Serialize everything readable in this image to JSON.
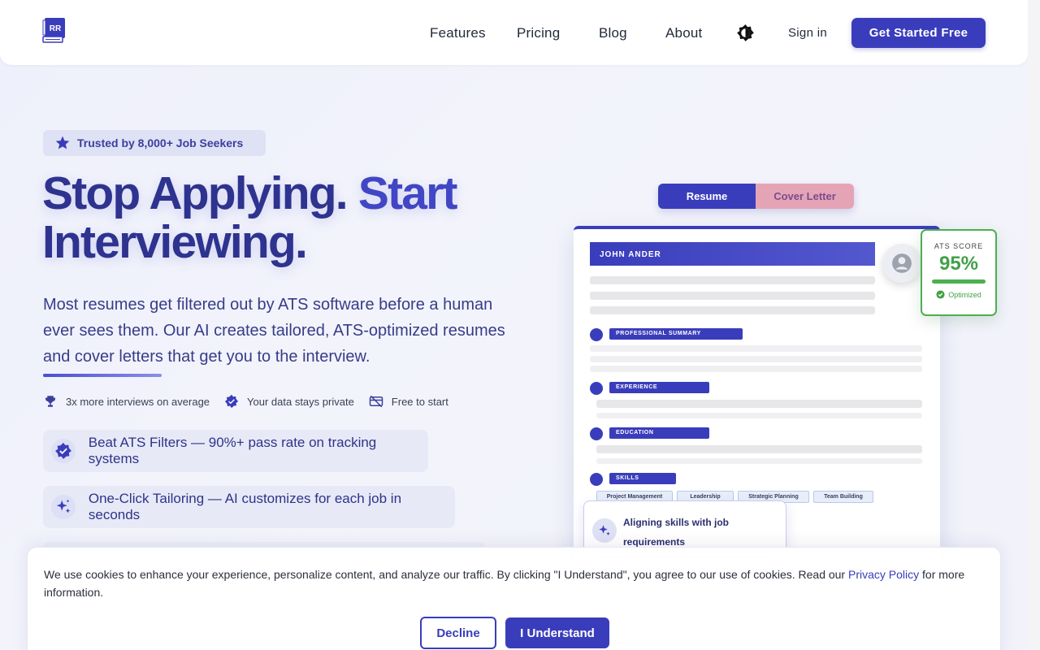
{
  "brand": {
    "logo_text": "RR",
    "color": "#3a3dbb"
  },
  "nav": {
    "items": [
      {
        "label": "Features"
      },
      {
        "label": "Pricing"
      },
      {
        "label": "Blog"
      },
      {
        "label": "About"
      }
    ],
    "theme_icon": "contrast-icon",
    "signin_label": "Sign in",
    "cta_label": "Get Started Free"
  },
  "hero": {
    "badge": "Trusted by 8,000+ Job Seekers",
    "headline_part1": "Stop Applying.",
    "headline_part2": "Start",
    "headline_part3": "Interviewing.",
    "description": "Most resumes get filtered out by ATS software before a human ever sees them. Our AI creates tailored, ATS-optimized resumes and cover letters that get you to the interview.",
    "stats": [
      {
        "icon": "trophy-icon",
        "label": "3x more interviews on average"
      },
      {
        "icon": "verified-icon",
        "label": "Your data stays private"
      },
      {
        "icon": "no-card-icon",
        "label": "Free to start"
      }
    ],
    "features": [
      {
        "icon": "check-badge-icon",
        "label": "Beat ATS Filters — 90%+ pass rate on tracking systems"
      },
      {
        "icon": "sparkle-icon",
        "label": "One-Click Tailoring — AI customizes for each job in seconds"
      }
    ]
  },
  "preview": {
    "tabs": [
      "Resume",
      "Cover Letter"
    ],
    "name": "JOHN ANDER",
    "sections": [
      "PROFESSIONAL SUMMARY",
      "EXPERIENCE",
      "EDUCATION",
      "SKILLS"
    ],
    "skills": [
      "Project Management",
      "Leadership",
      "Strategic Planning",
      "Team Building"
    ],
    "ats": {
      "label": "ATS SCORE",
      "value": "95%",
      "status": "Optimized",
      "score_fraction": 0.95
    },
    "status_card": "Aligning skills with job requirements"
  },
  "cookie": {
    "text_before": "We use cookies to enhance your experience, personalize content, and analyze our traffic. By clicking \"I Understand\", you agree to our use of cookies. Read our ",
    "link": "Privacy Policy",
    "text_after": " for more information.",
    "decline_label": "Decline",
    "accept_label": "I Understand"
  }
}
